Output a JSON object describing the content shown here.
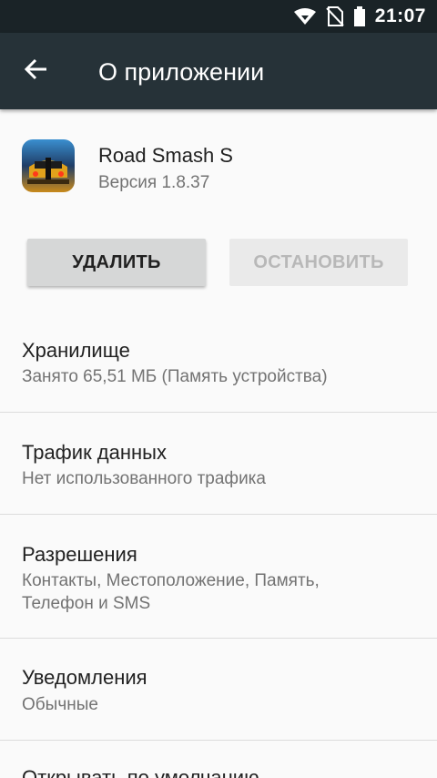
{
  "status_bar": {
    "time": "21:07",
    "icons": [
      "wifi-icon",
      "no-sim-icon",
      "battery-icon"
    ]
  },
  "app_bar": {
    "title": "О приложении",
    "back_icon": "arrow-back-icon",
    "background": "#263238"
  },
  "app": {
    "name": "Road Smash S",
    "version": "Версия 1.8.37",
    "icon": "game-car-icon"
  },
  "buttons": {
    "uninstall": "УДАЛИТЬ",
    "stop": "ОСТАНОВИТЬ"
  },
  "settings": [
    {
      "title": "Хранилище",
      "summary": "Занято 65,51 МБ (Память устройства)"
    },
    {
      "title": "Трафик данных",
      "summary": "Нет использованного трафика"
    },
    {
      "title": "Разрешения",
      "summary": "Контакты, Местоположение, Память, Телефон и SMS"
    },
    {
      "title": "Уведомления",
      "summary": "Обычные"
    },
    {
      "title": "Открывать по умолчанию",
      "summary": ""
    }
  ]
}
